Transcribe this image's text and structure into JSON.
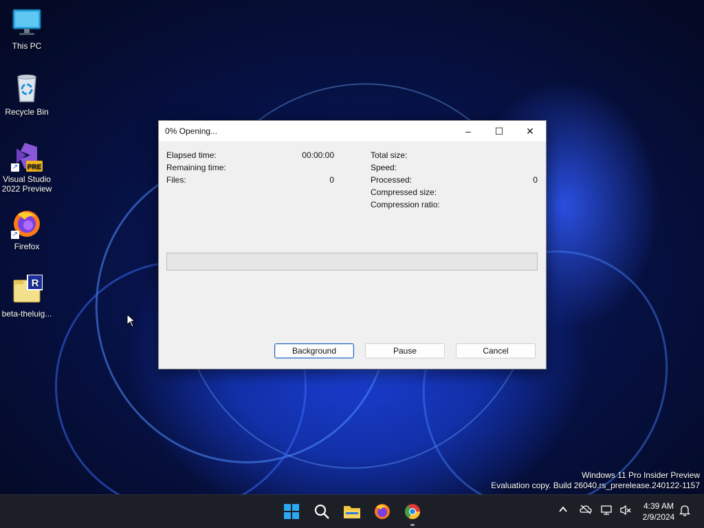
{
  "desktop": {
    "icons": [
      {
        "label": "This PC",
        "icon": "monitor-icon"
      },
      {
        "label": "Recycle Bin",
        "icon": "recycle-bin-icon"
      },
      {
        "label": "Visual Studio\n2022 Preview",
        "icon": "visual-studio-icon",
        "badge": "PRE"
      },
      {
        "label": "Firefox",
        "icon": "firefox-icon"
      },
      {
        "label": "beta-theluig...",
        "icon": "archive-icon",
        "badge": "R"
      }
    ],
    "watermark": {
      "line1": "Windows 11 Pro Insider Preview",
      "line2": "Evaluation copy. Build 26040.rs_prerelease.240122-1157"
    }
  },
  "dialog": {
    "title": "0% Opening...",
    "controls": {
      "minimize": "–",
      "maximize": "☐",
      "close": "✕"
    },
    "left_stats": [
      {
        "label": "Elapsed time:",
        "value": "00:00:00"
      },
      {
        "label": "Remaining time:",
        "value": ""
      },
      {
        "label": "Files:",
        "value": "0"
      }
    ],
    "right_stats": [
      {
        "label": "Total size:",
        "value": ""
      },
      {
        "label": "Speed:",
        "value": ""
      },
      {
        "label": "Processed:",
        "value": "0"
      },
      {
        "label": "Compressed size:",
        "value": ""
      },
      {
        "label": "Compression ratio:",
        "value": ""
      }
    ],
    "progress": 0,
    "buttons": {
      "background": "Background",
      "pause": "Pause",
      "cancel": "Cancel"
    }
  },
  "taskbar": {
    "apps": [
      "windows-start-icon",
      "search-icon",
      "file-explorer-icon",
      "firefox-icon",
      "chrome-icon"
    ],
    "tray": [
      "chevron-up-icon",
      "onedrive-icon",
      "network-icon",
      "volume-muted-icon"
    ],
    "clock": {
      "time": "4:39 AM",
      "date": "2/9/2024"
    },
    "notification_icon": "bell-icon"
  },
  "colors": {
    "accent": "#1f5fb8",
    "progress_fill": "#06b025",
    "taskbar": "#1c1f26"
  }
}
